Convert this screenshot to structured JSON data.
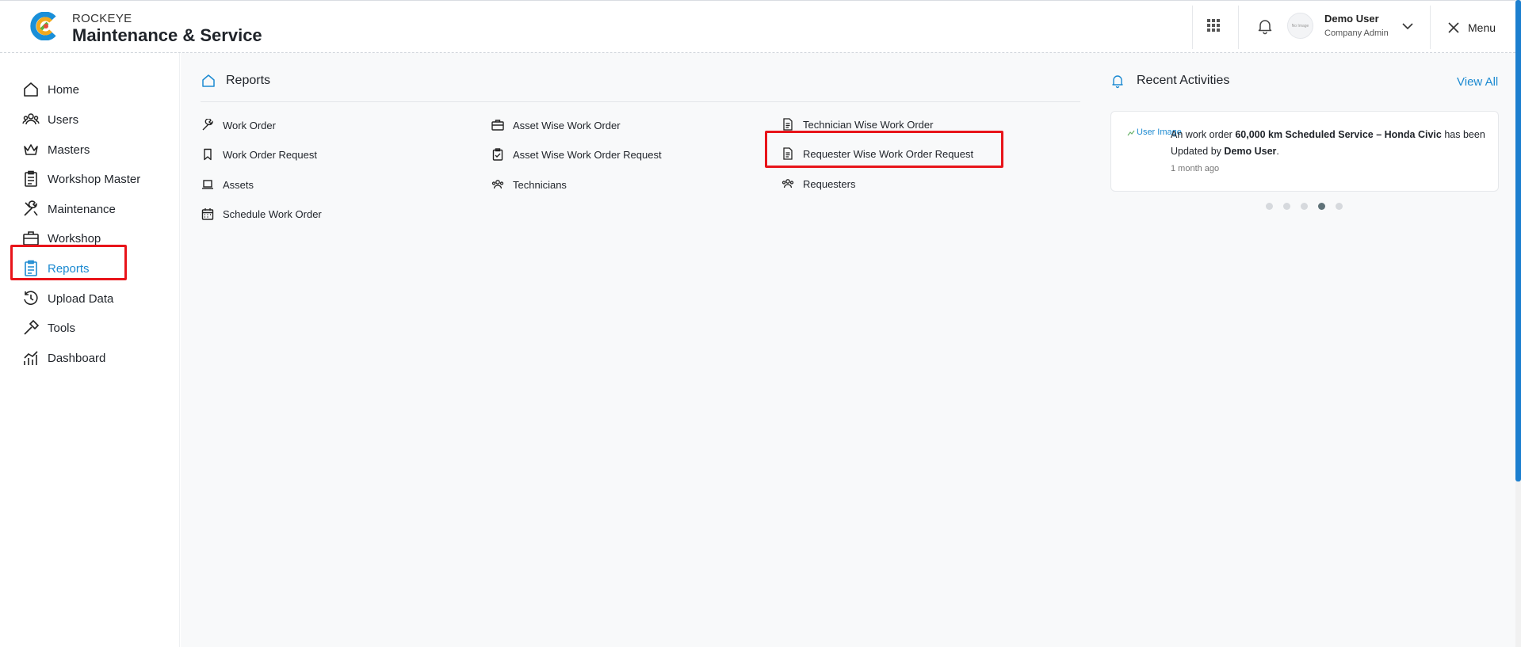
{
  "header": {
    "brand_top": "ROCKEYE",
    "brand_main": "Maintenance & Service",
    "user": {
      "name": "Demo User",
      "role": "Company Admin",
      "avatar_alt": "No Image"
    },
    "menu_label": "Menu"
  },
  "sidebar": {
    "items": [
      {
        "label": "Home",
        "icon": "home-icon",
        "active": false
      },
      {
        "label": "Users",
        "icon": "users-icon",
        "active": false
      },
      {
        "label": "Masters",
        "icon": "crown-icon",
        "active": false
      },
      {
        "label": "Workshop Master",
        "icon": "clipboard-icon",
        "active": false
      },
      {
        "label": "Maintenance",
        "icon": "tools-icon",
        "active": false
      },
      {
        "label": "Workshop",
        "icon": "briefcase-icon",
        "active": false
      },
      {
        "label": "Reports",
        "icon": "report-clipboard-icon",
        "active": true
      },
      {
        "label": "Upload Data",
        "icon": "history-icon",
        "active": false
      },
      {
        "label": "Tools",
        "icon": "hammer-icon",
        "active": false
      },
      {
        "label": "Dashboard",
        "icon": "chart-icon",
        "active": false
      }
    ]
  },
  "reports": {
    "title": "Reports",
    "links": [
      {
        "label": "Work Order",
        "icon": "wrench-icon"
      },
      {
        "label": "Work Order Request",
        "icon": "bookmark-icon"
      },
      {
        "label": "Assets",
        "icon": "laptop-icon"
      },
      {
        "label": "Schedule Work Order",
        "icon": "calendar-icon"
      },
      {
        "label": "Asset Wise Work Order",
        "icon": "briefcase-icon"
      },
      {
        "label": "Asset Wise Work Order Request",
        "icon": "clipboard-check-icon"
      },
      {
        "label": "Technicians",
        "icon": "users-icon"
      },
      {
        "label": "Technician Wise Work Order",
        "icon": "document-icon"
      },
      {
        "label": "Requester Wise Work Order Request",
        "icon": "document-icon"
      },
      {
        "label": "Requesters",
        "icon": "users-icon"
      }
    ]
  },
  "recent_activities": {
    "title": "Recent Activities",
    "view_all": "View All",
    "card": {
      "image_alt": "User Image",
      "text_prefix": "work order",
      "text_prefix_lead": "An",
      "subject": "60,000 km Scheduled Service – Honda Civic",
      "text_middle": "has been Updated by",
      "actor": "Demo User",
      "text_end": ".",
      "time": "1 month ago"
    },
    "dots": 5,
    "active_dot": 3
  },
  "colors": {
    "accent": "#1c8ad1",
    "highlight": "#e8141a",
    "main_bg": "#f8f9fa"
  }
}
